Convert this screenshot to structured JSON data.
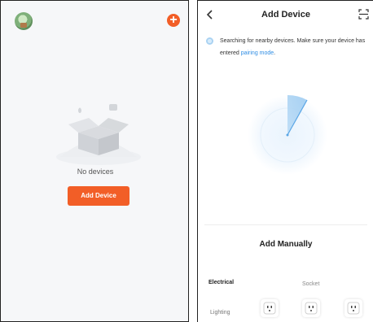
{
  "home": {
    "avatar_icon": "home-avatar-icon",
    "plus_icon": "plus-icon",
    "empty_text": "No devices",
    "add_button_label": "Add Device",
    "accent": "#f25e27"
  },
  "add_device": {
    "title": "Add Device",
    "search_text": "Searching for nearby devices. Make sure your device has entered",
    "search_link": "pairing mode",
    "search_suffix": ".",
    "manual_title": "Add Manually",
    "categories": [
      "Electrical",
      "Lighting"
    ],
    "subcategory": "Socket",
    "link_color": "#2f8de4"
  }
}
